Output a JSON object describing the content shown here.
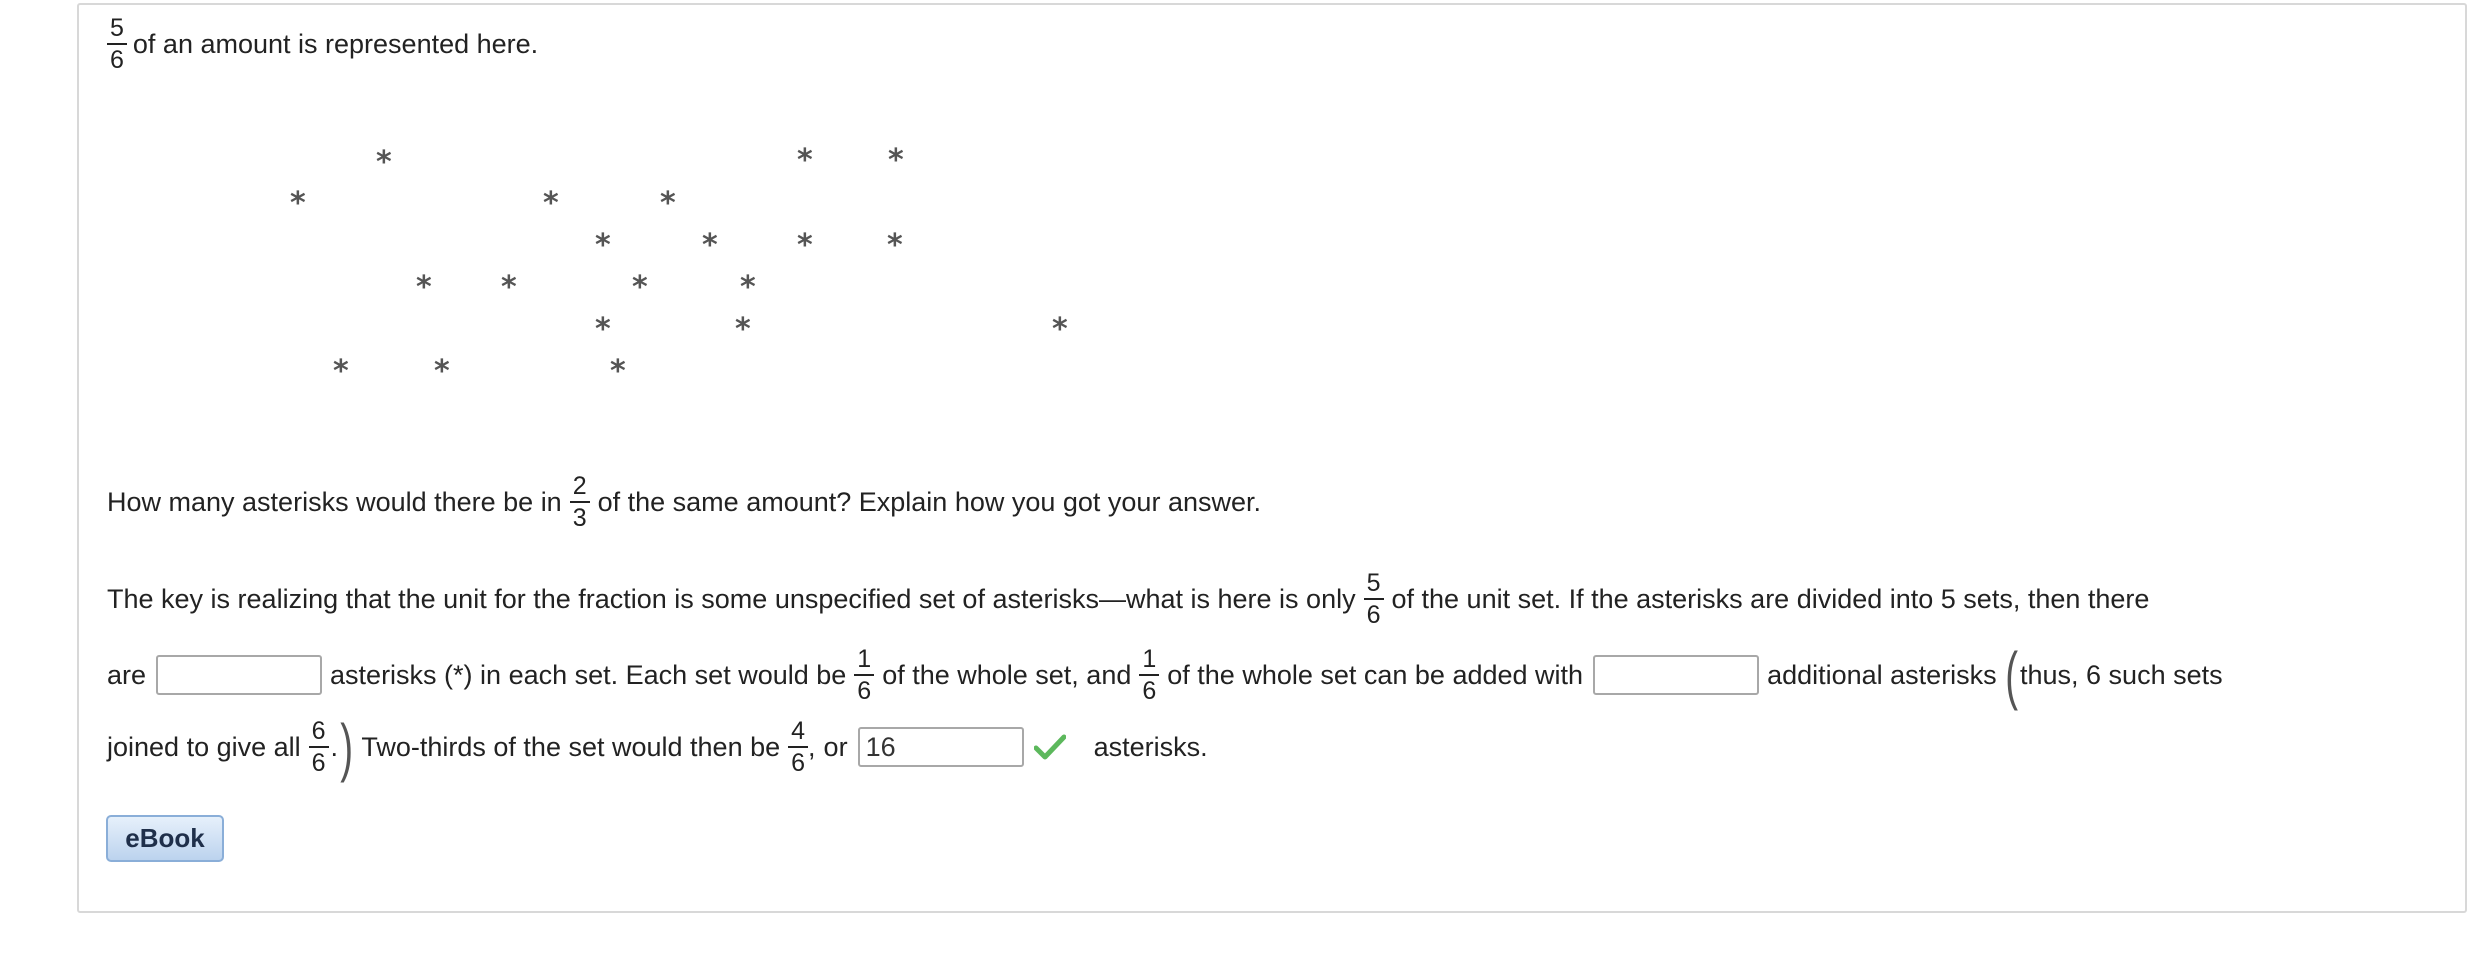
{
  "intro": {
    "fraction": {
      "numerator": "5",
      "denominator": "6"
    },
    "text": "of an amount is represented here."
  },
  "asterisk_figure": {
    "symbol": "*",
    "count": 20
  },
  "question": {
    "part1": "How many asterisks would there be in",
    "fraction": {
      "numerator": "2",
      "denominator": "3"
    },
    "part2": "of the same amount? Explain how you got your answer."
  },
  "explanation": {
    "line1_part1": "The key is realizing that the unit for the fraction is some unspecified set of asterisks—what is here is only",
    "line1_fraction": {
      "numerator": "5",
      "denominator": "6"
    },
    "line1_part2": "of the unit set. If the asterisks are divided into 5 sets, then there",
    "line2_part1": "are",
    "input1_value": "",
    "line2_part2": "asterisks (*) in each set. Each set would be",
    "line2_fraction1": {
      "numerator": "1",
      "denominator": "6"
    },
    "line2_part3": "of the whole set, and",
    "line2_fraction2": {
      "numerator": "1",
      "denominator": "6"
    },
    "line2_part4": "of the whole set can be added with",
    "input2_value": "",
    "line2_part5": "additional asterisks",
    "paren_open": "(",
    "line2_part6": "thus, 6 such sets",
    "line3_part1": "joined to give all",
    "line3_fraction1": {
      "numerator": "6",
      "denominator": "6"
    },
    "line3_period": ".",
    "paren_close": ")",
    "line3_part2": "Two-thirds of the set would then be",
    "line3_fraction2": {
      "numerator": "4",
      "denominator": "6"
    },
    "line3_comma": ",",
    "line3_or": "or",
    "input3_value": "16",
    "input3_status": "correct",
    "line3_part3": "asterisks."
  },
  "buttons": {
    "ebook_label": "eBook"
  },
  "colors": {
    "check": "#5cb85c",
    "ebook_border": "#8aaed8",
    "asterisk": "#555555"
  }
}
